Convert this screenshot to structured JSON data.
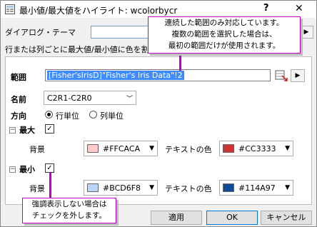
{
  "window": {
    "title": "最小値/最大値をハイライト: wcolorbycr",
    "help": "?",
    "close": "✕"
  },
  "theme": {
    "label": "ダイアログ・テーマ",
    "value": "",
    "arrow": "▶"
  },
  "description": "行または列ごとに最大値/最小値に色を割",
  "range": {
    "label": "範囲",
    "value": "[Fisher'sIrisD]\"Fisher's Iris Data\"!2",
    "arrow": "▶"
  },
  "name": {
    "label": "名前",
    "value": "C2R1-C2R0"
  },
  "direction": {
    "label": "方向",
    "options": [
      {
        "label": "行単位",
        "selected": true
      },
      {
        "label": "列単位",
        "selected": false
      }
    ]
  },
  "max": {
    "label": "最大",
    "checked": true,
    "bg_label": "背景",
    "bg_color": "#FFCACA",
    "text_label": "テキストの色",
    "text_color": "#CC3333"
  },
  "min": {
    "label": "最小",
    "checked": true,
    "bg_label": "背景",
    "bg_color": "#BCD6F8",
    "text_label": "テキストの色",
    "text_color": "#114A97"
  },
  "buttons": {
    "apply": "適用",
    "ok": "OK",
    "cancel": "キャンセル"
  },
  "callouts": {
    "top": [
      "連続した範囲のみ対応しています。",
      "複数の範囲を選択した場合は、",
      "最初の範囲だけが使用されます。"
    ],
    "bottom": [
      "強調表示しない場合は",
      "チェックを外します。"
    ]
  },
  "colors": {
    "accent": "#c000c0",
    "selection": "#3f8cff"
  }
}
